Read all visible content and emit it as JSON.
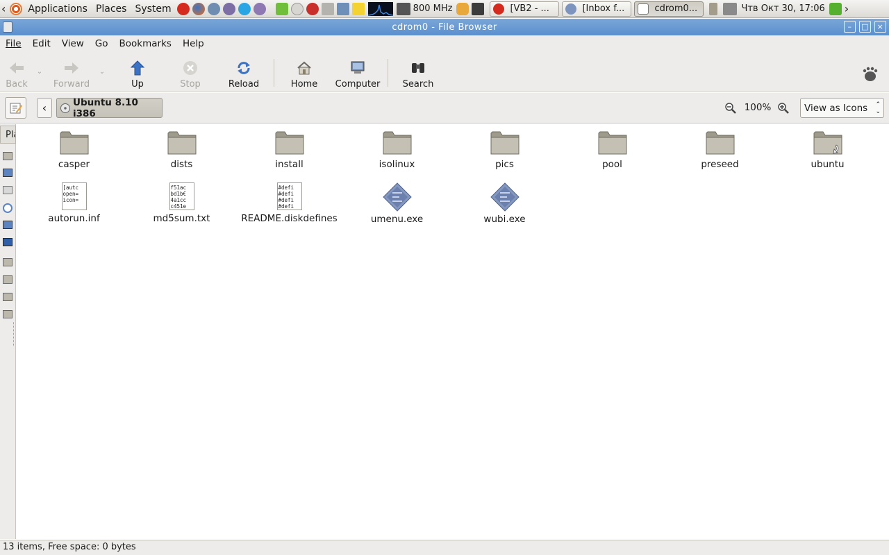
{
  "panel": {
    "menus": [
      "Applications",
      "Places",
      "System"
    ],
    "cpu_freq": "800 MHz",
    "tasks": [
      {
        "label": "[VB2 - ...",
        "icon": "opera-icon",
        "active": false
      },
      {
        "label": "[Inbox f...",
        "icon": "thunderbird-icon",
        "active": false
      },
      {
        "label": "cdrom0...",
        "icon": "file-browser-icon",
        "active": true
      }
    ],
    "clock": "Чтв Окт 30, 17:06",
    "scroll_left": "‹",
    "scroll_right": "›"
  },
  "window": {
    "title": "cdrom0 - File Browser"
  },
  "menubar": {
    "items": [
      "File",
      "Edit",
      "View",
      "Go",
      "Bookmarks",
      "Help"
    ]
  },
  "toolbar": {
    "back": "Back",
    "forward": "Forward",
    "up": "Up",
    "stop": "Stop",
    "reload": "Reload",
    "home": "Home",
    "computer": "Computer",
    "search": "Search"
  },
  "location": {
    "path_button": "Ubuntu 8.10 i386",
    "zoom": "100%",
    "view_mode": "View as Icons",
    "back_arrow": "‹"
  },
  "sidebar": {
    "title_clip": "Pla"
  },
  "files": [
    {
      "name": "casper",
      "type": "folder"
    },
    {
      "name": "dists",
      "type": "folder"
    },
    {
      "name": "install",
      "type": "folder"
    },
    {
      "name": "isolinux",
      "type": "folder"
    },
    {
      "name": "pics",
      "type": "folder"
    },
    {
      "name": "pool",
      "type": "folder"
    },
    {
      "name": "preseed",
      "type": "folder"
    },
    {
      "name": "ubuntu",
      "type": "folder-link"
    },
    {
      "name": "autorun.inf",
      "type": "text",
      "preview": "[autc\nopen=\nicon="
    },
    {
      "name": "md5sum.txt",
      "type": "text",
      "preview": "f51ac\nbd1b€\n4a1cc\nc451e"
    },
    {
      "name": "README.diskdefines",
      "type": "text",
      "preview": "#defi\n#defi\n#defi\n#defi"
    },
    {
      "name": "umenu.exe",
      "type": "exe"
    },
    {
      "name": "wubi.exe",
      "type": "exe"
    }
  ],
  "status": {
    "text": "13 items, Free space: 0 bytes"
  },
  "colors": {
    "titlebar": "#5b8fcf",
    "panel": "#dcdad5",
    "folder": "#b9b6a8"
  }
}
